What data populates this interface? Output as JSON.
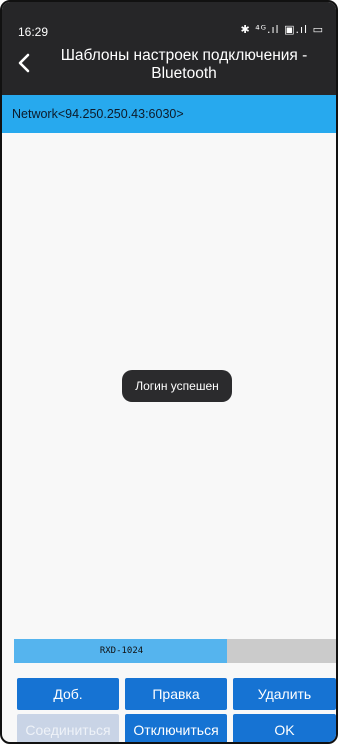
{
  "status_bar": {
    "time": "16:29",
    "icons_text": "✱ ⁴ᴳ.ıl ▣.ıl ▭"
  },
  "header": {
    "title": "Шаблоны настроек подключения - Bluetooth"
  },
  "list": {
    "items": [
      {
        "label": "Network<94.250.250.43:6030>"
      }
    ]
  },
  "toast": {
    "message": "Логин успешен"
  },
  "progress": {
    "label": "RXD-1024",
    "fill_fraction": 0.66
  },
  "buttons": {
    "add": "Доб.",
    "edit": "Правка",
    "delete": "Удалить",
    "connect": "Соединиться",
    "disconnect": "Отключиться",
    "ok": "OK"
  },
  "colors": {
    "header_bg": "#262628",
    "selected_item_bg": "#27a9ee",
    "button_bg": "#1673d3",
    "button_disabled_bg": "#c9d4e6",
    "progress_fill": "#55b4ee",
    "progress_track": "#cbcbcb"
  }
}
